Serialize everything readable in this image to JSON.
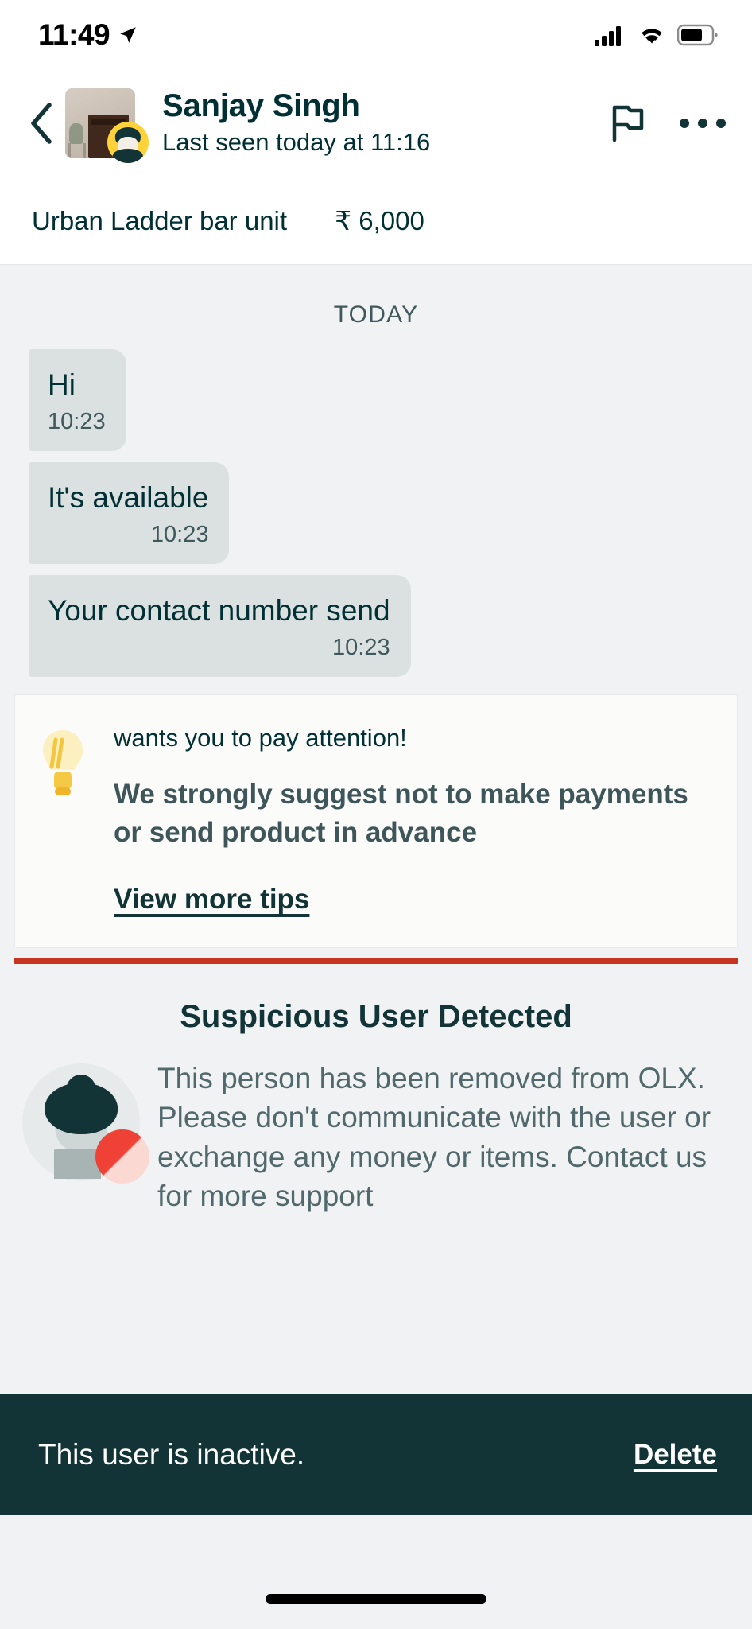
{
  "status_bar": {
    "time": "11:49",
    "location_icon": "location-arrow-icon",
    "cellular_icon": "cellular-signal-icon",
    "wifi_icon": "wifi-icon",
    "battery_icon": "battery-icon",
    "battery_level": 60
  },
  "nav": {
    "back_icon": "chevron-left-icon",
    "thumbnail_icon": "listing-thumbnail",
    "avatar_icon": "user-avatar",
    "name": "Sanjay Singh",
    "last_seen": "Last seen today at 11:16",
    "flag_icon": "flag-icon",
    "more_icon": "more-options-icon"
  },
  "product": {
    "title": "Urban Ladder bar unit",
    "price": "₹ 6,000"
  },
  "chat": {
    "day_separator": "TODAY",
    "messages": [
      {
        "text": "Hi",
        "time": "10:23",
        "side": "incoming"
      },
      {
        "text": "It's available",
        "time": "10:23",
        "side": "incoming"
      },
      {
        "text": "Your contact number send",
        "time": "10:23",
        "side": "incoming"
      }
    ]
  },
  "safety_tip": {
    "bulb_icon": "lightbulb-icon",
    "lead": "wants you to pay attention!",
    "headline": "We strongly suggest not to make payments or send product in advance",
    "link_label": "View more tips",
    "rule_color": "#c6351f"
  },
  "suspicious": {
    "illustration_icon": "suspicious-user-illustration",
    "title": "Suspicious User Detected",
    "body": "This person has been removed from OLX. Please don't communicate with the user or exchange any money or items. Contact us for more support"
  },
  "inactive_bar": {
    "message": "This user is inactive.",
    "delete_label": "Delete",
    "background": "#123437"
  },
  "home_indicator": "home-indicator",
  "colors": {
    "brand_dark": "#002f34",
    "teal_dark": "#123437",
    "chat_bg": "#f0f2f3",
    "bubble": "#dbe1e1",
    "accent_red": "#c6351f",
    "avatar_yellow": "#ffd23c"
  }
}
